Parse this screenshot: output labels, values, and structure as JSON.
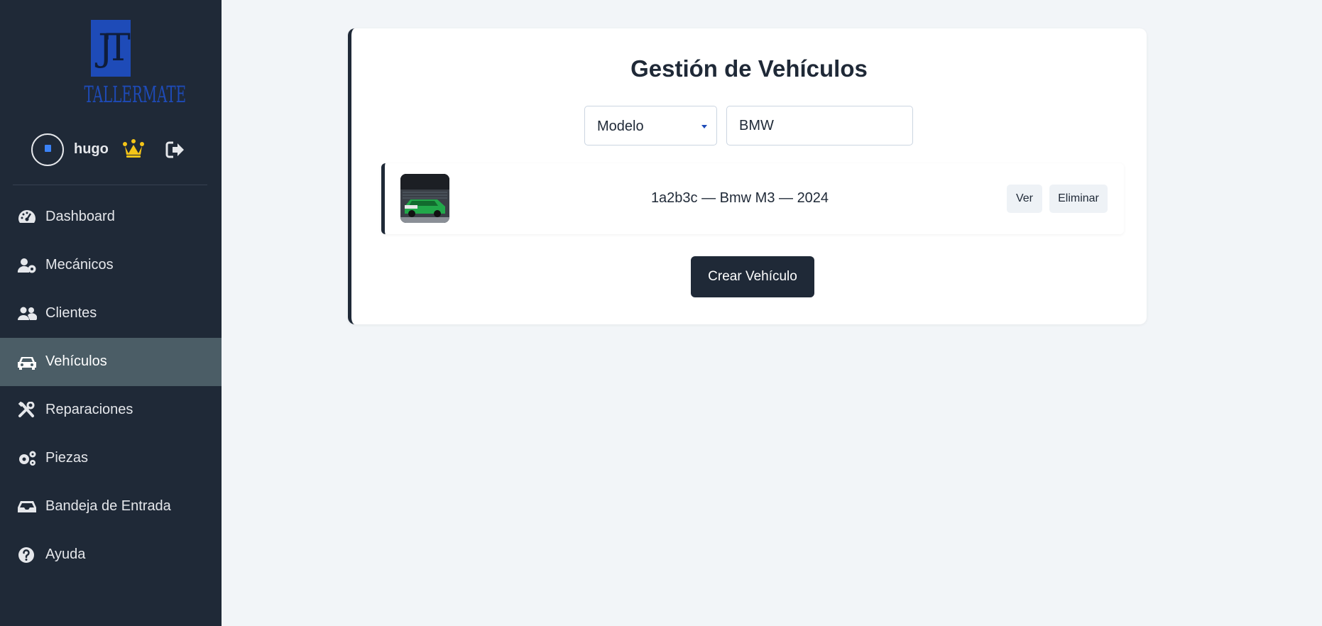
{
  "app": {
    "brand": "TALLERMATE",
    "monogram": "JT",
    "brand_color": "#1e4bb8",
    "sidebar_bg": "#1f2937"
  },
  "user": {
    "name": "hugo",
    "avatar_icon": "cube-icon",
    "role_icon": "crown-icon",
    "logout_icon": "logout-icon"
  },
  "sidebar": {
    "items": [
      {
        "label": "Dashboard",
        "icon": "gauge-icon",
        "active": false
      },
      {
        "label": "Mecánicos",
        "icon": "user-gear-icon",
        "active": false
      },
      {
        "label": "Clientes",
        "icon": "users-icon",
        "active": false
      },
      {
        "label": "Vehículos",
        "icon": "car-icon",
        "active": true
      },
      {
        "label": "Reparaciones",
        "icon": "tools-icon",
        "active": false
      },
      {
        "label": "Piezas",
        "icon": "gears-icon",
        "active": false
      },
      {
        "label": "Bandeja de Entrada",
        "icon": "inbox-icon",
        "active": false
      },
      {
        "label": "Ayuda",
        "icon": "help-icon",
        "active": false
      }
    ]
  },
  "main": {
    "title": "Gestión de Vehículos",
    "filter": {
      "field_selected": "Modelo",
      "search_value": "BMW"
    },
    "vehicles": [
      {
        "text": "1a2b3c — Bmw M3 — 2024",
        "view_label": "Ver",
        "delete_label": "Eliminar"
      }
    ],
    "create_label": "Crear Vehículo"
  }
}
